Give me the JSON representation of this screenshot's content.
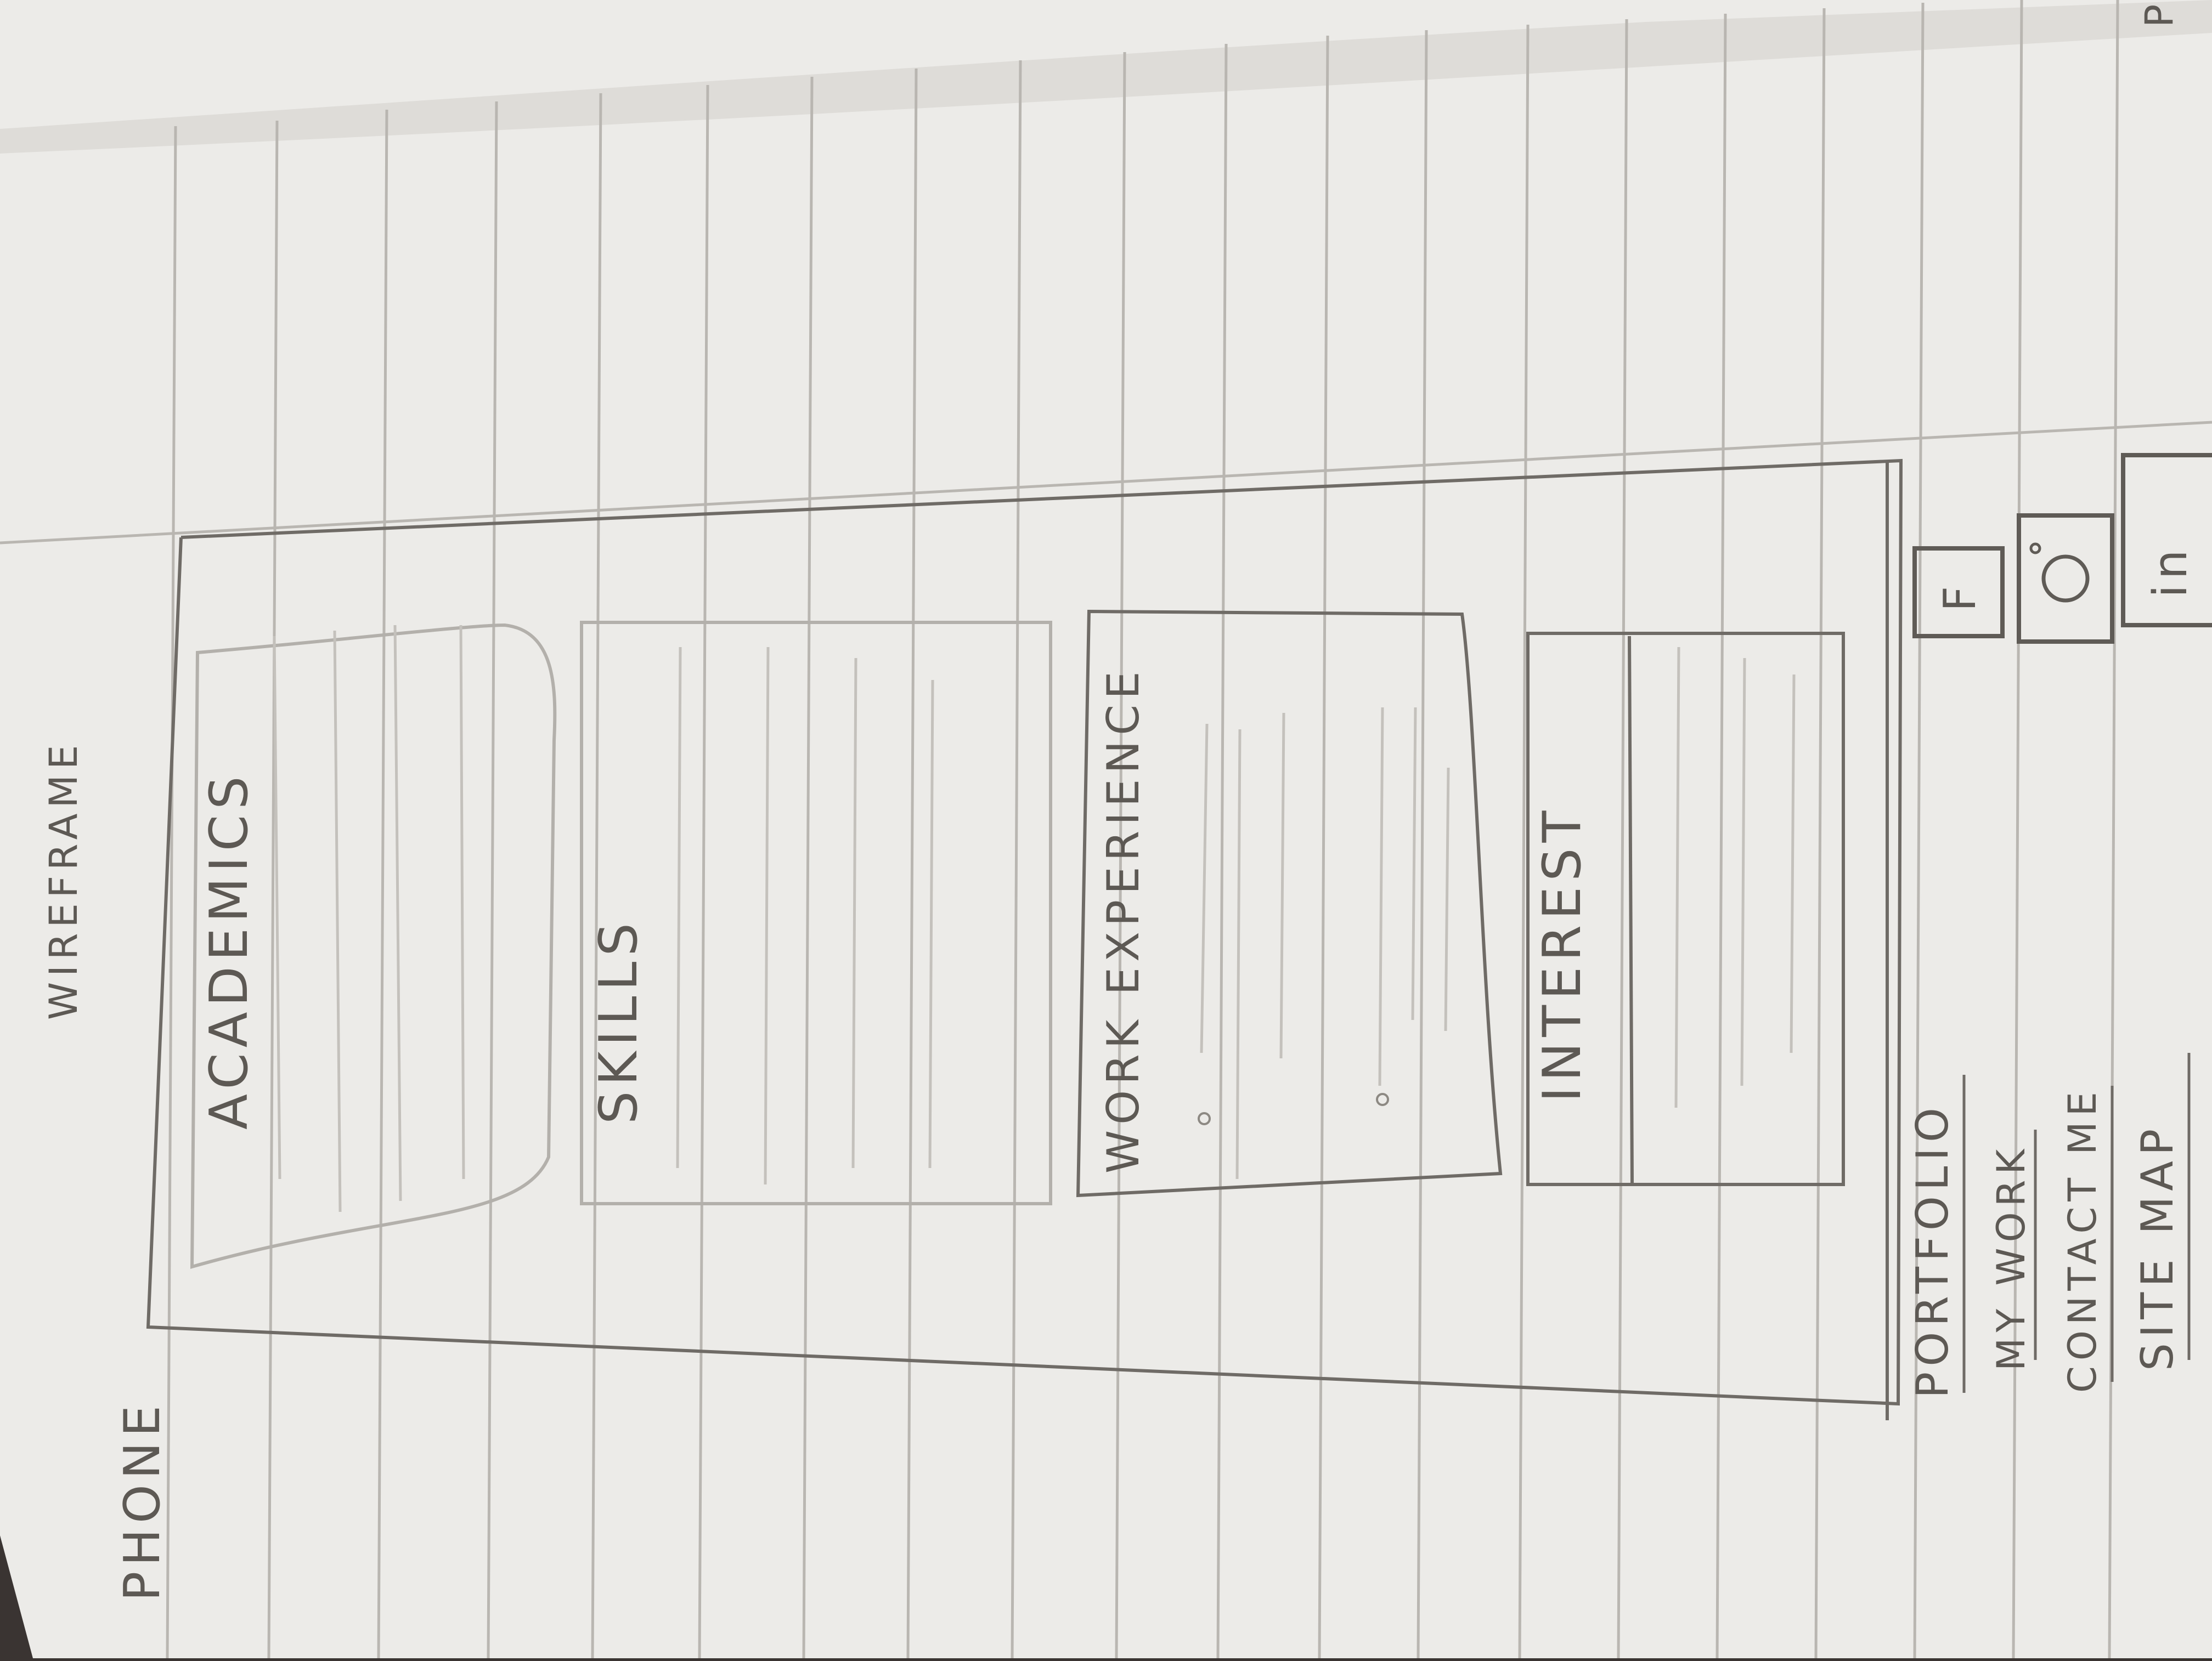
{
  "page": {
    "device_label": "PHONE",
    "title": "WIREFRAME",
    "corner_mark": "P"
  },
  "sections": [
    {
      "id": "academics",
      "label": "ACADEMICS"
    },
    {
      "id": "skills",
      "label": "SKILLS"
    },
    {
      "id": "work-experience",
      "label": "WORK EXPERIENCE"
    },
    {
      "id": "interest",
      "label": "INTEREST"
    }
  ],
  "footer": {
    "nav_items": [
      "PORTFOLIO",
      "MY WORK",
      "CONTACT ME",
      "SITE MAP"
    ],
    "social_icons": [
      "facebook-icon",
      "instagram-icon",
      "linkedin-icon"
    ],
    "facebook_glyph": "F",
    "linkedin_glyph": "in"
  },
  "colors": {
    "paper": "#ecebe8",
    "rule_line": "#b9b6b1",
    "pencil": "#6f6b66",
    "background": "#3a3432"
  }
}
